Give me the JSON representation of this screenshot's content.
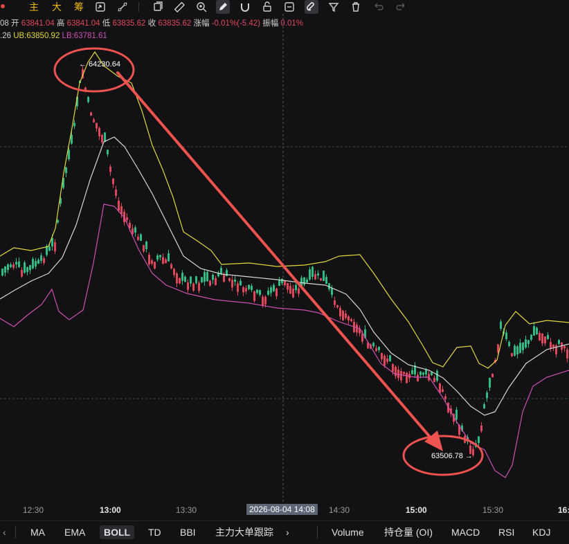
{
  "toolbar": {
    "label_main": "主",
    "label_big": "大",
    "label_chip": "筹",
    "icons": [
      "refresh-icon",
      "trend-line-icon",
      "copy-icon",
      "ruler-icon",
      "zoom-icon",
      "pencil-icon",
      "magnet-icon",
      "lock-icon",
      "hide-icon",
      "magnet-active-icon",
      "filter-icon",
      "delete-icon",
      "undo-icon",
      "redo-icon"
    ]
  },
  "quote": {
    "prefix": "08",
    "open_label": "开",
    "open": "63841.04",
    "high_label": "高",
    "high": "63841.04",
    "low_label": "低",
    "low": "63835.62",
    "close_label": "收",
    "close": "63835.62",
    "change_label": "涨幅",
    "change": "-0.01%(-5.42)",
    "amp_label": "振幅",
    "amp": "0.01%"
  },
  "boll_values": {
    "mid": ".26",
    "ub": "UB:63850.92",
    "lb": "LB:63781.61"
  },
  "annotations": {
    "high_marker": "← 64230.64",
    "low_marker": "63506.78 →"
  },
  "xaxis": {
    "t1": "12:30",
    "t2": "13:00",
    "t3": "13:30",
    "cursor": "2026-08-04 14:08",
    "t4": "14:30",
    "t5": "15:00",
    "t6": "15:30",
    "t7": "16:"
  },
  "bottom": {
    "indicators": [
      "MA",
      "EMA",
      "BOLL",
      "TD",
      "BBI",
      "主力大单跟踪"
    ],
    "active": "BOLL",
    "more": "›",
    "sub_indicators": [
      "Volume",
      "持仓量 (OI)",
      "MACD",
      "RSI",
      "KDJ"
    ]
  },
  "colors": {
    "up": "#2ebd85",
    "down": "#e0485a",
    "ub": "#e6d83a",
    "mid": "#d8d8d8",
    "lb": "#cf4fb3",
    "arrow": "#ef5350"
  }
}
